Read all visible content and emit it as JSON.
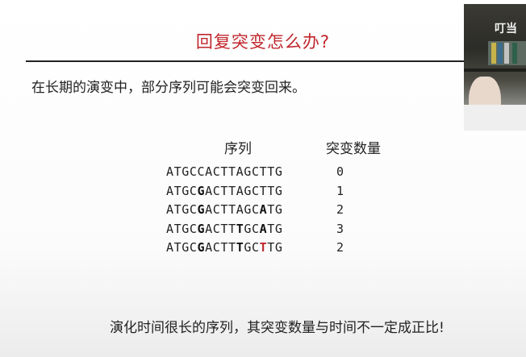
{
  "title": "回复突变怎么办?",
  "intro": "在长期的演变中，部分序列可能会突变回来。",
  "table": {
    "header_sequence": "序列",
    "header_count": "突变数量",
    "rows": [
      {
        "segments": [
          {
            "text": "ATGCCACTTAGCTTG",
            "style": "n"
          }
        ],
        "count": "0"
      },
      {
        "segments": [
          {
            "text": "ATGC",
            "style": "n"
          },
          {
            "text": "G",
            "style": "b"
          },
          {
            "text": "ACTTAGCTTG",
            "style": "n"
          }
        ],
        "count": "1"
      },
      {
        "segments": [
          {
            "text": "ATGC",
            "style": "n"
          },
          {
            "text": "G",
            "style": "b"
          },
          {
            "text": "ACTTAGC",
            "style": "n"
          },
          {
            "text": "A",
            "style": "b"
          },
          {
            "text": "TG",
            "style": "n"
          }
        ],
        "count": "2"
      },
      {
        "segments": [
          {
            "text": "ATGC",
            "style": "n"
          },
          {
            "text": "G",
            "style": "b"
          },
          {
            "text": "ACTT",
            "style": "n"
          },
          {
            "text": "T",
            "style": "b"
          },
          {
            "text": "GC",
            "style": "n"
          },
          {
            "text": "A",
            "style": "b"
          },
          {
            "text": "TG",
            "style": "n"
          }
        ],
        "count": "3"
      },
      {
        "segments": [
          {
            "text": "ATGC",
            "style": "n"
          },
          {
            "text": "G",
            "style": "b"
          },
          {
            "text": "ACTT",
            "style": "n"
          },
          {
            "text": "T",
            "style": "b"
          },
          {
            "text": "GC",
            "style": "n"
          },
          {
            "text": "T",
            "style": "r"
          },
          {
            "text": "TG",
            "style": "n"
          }
        ],
        "count": "2"
      }
    ]
  },
  "footer": "演化时间很长的序列，其突变数量与时间不一定成正比!",
  "video": {
    "watermark": "叮当"
  },
  "colors": {
    "title": "#c0272d",
    "highlight_red": "#c0272d",
    "text": "#222222"
  }
}
